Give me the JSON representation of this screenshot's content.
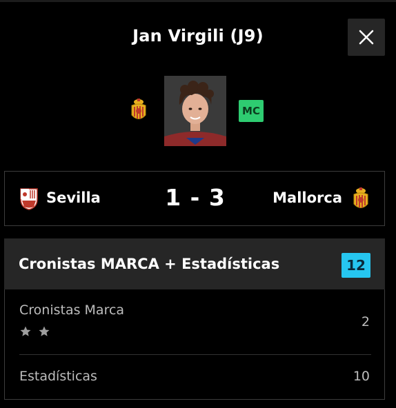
{
  "player": {
    "name": "Jan Virgili (J9)",
    "position": "MC"
  },
  "match": {
    "home_team": "Sevilla",
    "score": "1 - 3",
    "away_team": "Mallorca"
  },
  "ratings": {
    "title": "Cronistas MARCA + Estadísticas",
    "total": "12",
    "rows": [
      {
        "label": "Cronistas Marca",
        "stars": 2,
        "value": "2"
      },
      {
        "label": "Estadísticas",
        "value": "10"
      }
    ]
  },
  "colors": {
    "position_badge": "#2ecc71",
    "total_badge": "#26c6f0",
    "panel": "#262626"
  }
}
